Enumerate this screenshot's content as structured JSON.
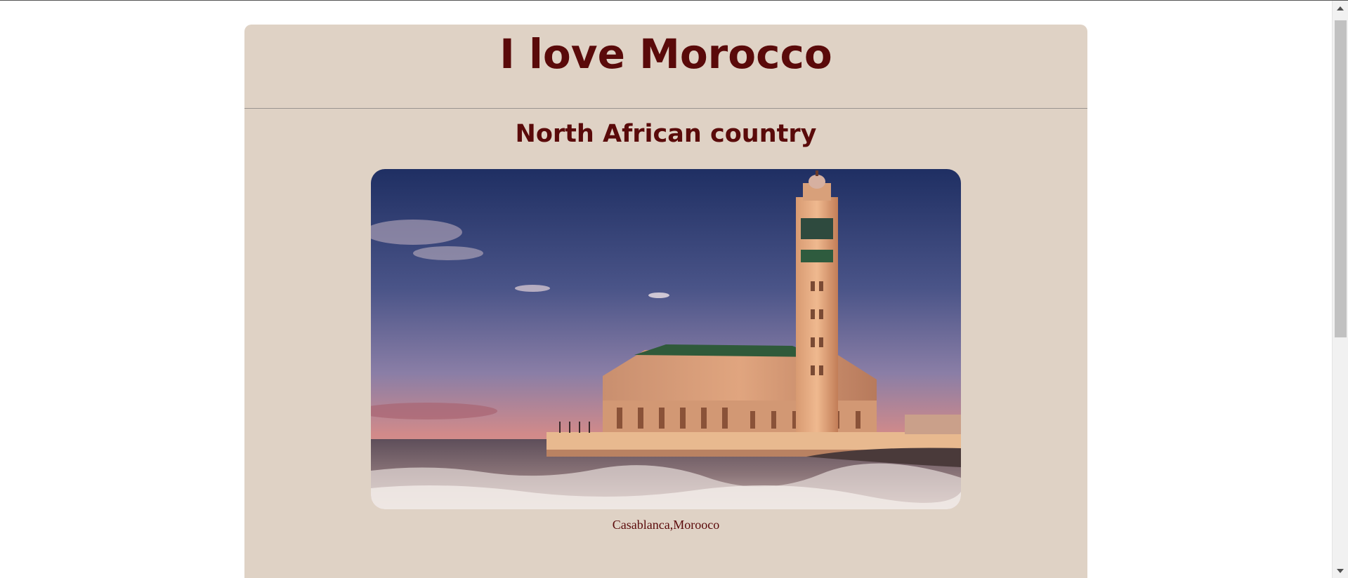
{
  "header": {
    "title": "I love Morocco"
  },
  "main": {
    "subtitle": "North African country",
    "image_alt": "Hassan II Mosque in Casablanca at sunset by the sea",
    "caption": "Casablanca,Morooco"
  },
  "scrollbar": {
    "up_icon": "chevron-up-icon",
    "down_icon": "chevron-down-icon"
  },
  "colors": {
    "card_background": "#dfd2c5",
    "heading_color": "#5a0a0a"
  }
}
